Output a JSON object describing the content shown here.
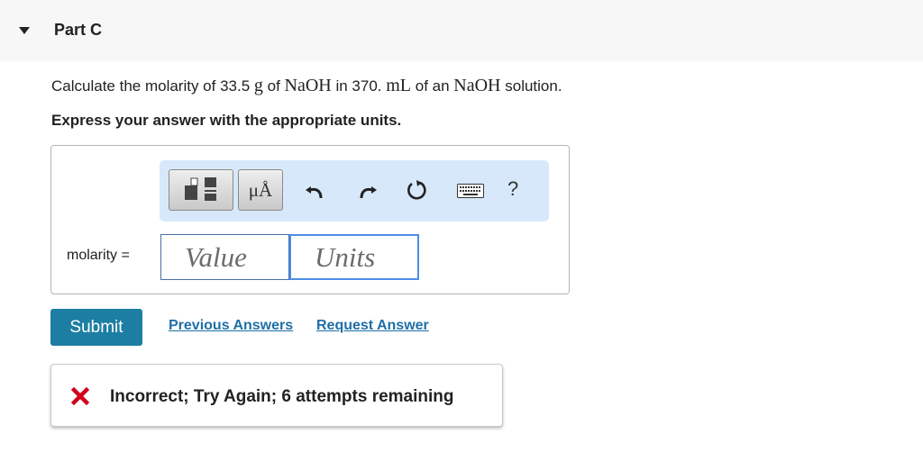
{
  "header": {
    "part_title": "Part C"
  },
  "question": {
    "t1": "Calculate the molarity of 33.5 ",
    "m1": "g",
    "t2": " of ",
    "m2": "NaOH",
    "t3": " in 370. ",
    "m3": "mL",
    "t4": " of an ",
    "m4": "NaOH",
    "t5": " solution."
  },
  "instruction": "Express your answer with the appropriate units.",
  "toolbar": {
    "units_label": "μÅ",
    "help_label": "?",
    "icons": [
      "templates-icon",
      "undo-icon",
      "redo-icon",
      "reset-icon",
      "keyboard-icon"
    ]
  },
  "answer": {
    "label": "molarity =",
    "value_placeholder": "Value",
    "units_placeholder": "Units"
  },
  "actions": {
    "submit_label": "Submit",
    "previous_answers_label": "Previous Answers",
    "request_answer_label": "Request Answer"
  },
  "feedback": {
    "message": "Incorrect; Try Again; 6 attempts remaining",
    "status_color": "#d0021b"
  },
  "colors": {
    "toolbar_bg": "#d7e8fb",
    "submit_bg": "#1d7ea3",
    "link": "#1f6fa8",
    "units_focus_border": "#4d8ee8"
  }
}
